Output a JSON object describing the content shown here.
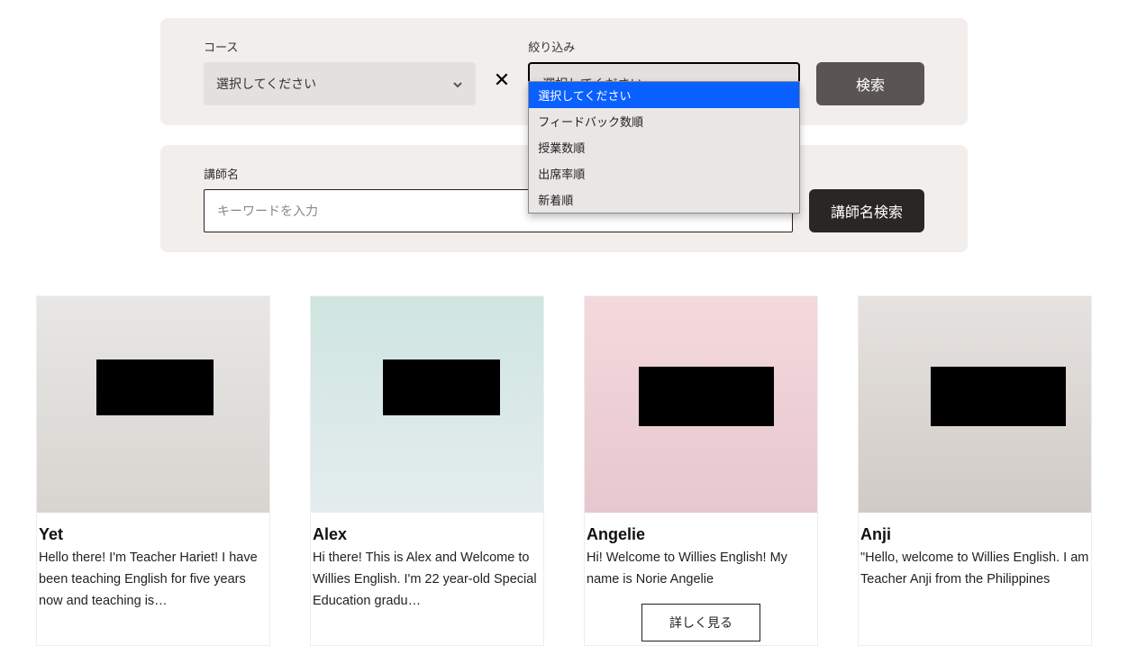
{
  "search_panel": {
    "course_label": "コース",
    "course_select_placeholder": "選択してください",
    "clear_symbol": "✕",
    "filter_label": "絞り込み",
    "filter_select_placeholder": "選択してください",
    "filter_options": [
      "選択してください",
      "フィードバック数順",
      "授業数順",
      "出席率順",
      "新着順"
    ],
    "search_button": "検索"
  },
  "name_panel": {
    "label": "講師名",
    "placeholder": "キーワードを入力",
    "button": "講師名検索"
  },
  "teachers": [
    {
      "name": "Yet",
      "bio": "Hello there! I'm Teacher Hariet! I have been teaching English for five years now and teaching is…"
    },
    {
      "name": "Alex",
      "bio": "Hi there! This is Alex and Welcome to Willies English. I'm 22 year-old Special Education gradu…"
    },
    {
      "name": "Angelie",
      "bio": "Hi! Welcome to Willies English! My name is Norie Angelie",
      "more_label": "詳しく見る"
    },
    {
      "name": "Anji",
      "bio": "\"Hello, welcome to Willies English. I am Teacher Anji from the Philippines"
    }
  ]
}
